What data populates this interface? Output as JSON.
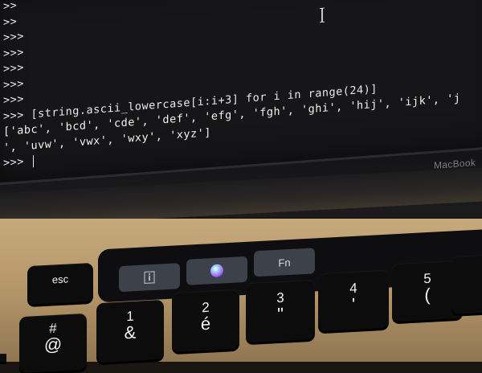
{
  "terminal": {
    "lines": [
      ">>",
      ">>",
      ">>>",
      ">>>",
      ">>>",
      ">>>",
      ">>>",
      ">>> [string.ascii_lowercase[i:i+3] for i in range(24)]",
      "['abc', 'bcd', 'cde', 'def', 'efg', 'fgh', 'ghi', 'hij', 'ijk', 'j",
      "', 'uvw', 'vwx', 'wxy', 'xyz']",
      ">>> "
    ]
  },
  "laptop": {
    "brand": "MacBook"
  },
  "touch_bar": {
    "fn_label": "Fn",
    "siri_icon": "siri-icon",
    "info_icon": "info-icon"
  },
  "keyboard": {
    "esc": "esc",
    "keys": [
      {
        "top": "#",
        "bottom": "@"
      },
      {
        "top": "1",
        "bottom": "&"
      },
      {
        "top": "2",
        "bottom": "é"
      },
      {
        "top": "3",
        "bottom": "\""
      },
      {
        "top": "4",
        "bottom": "'"
      },
      {
        "top": "5",
        "bottom": "("
      }
    ]
  },
  "colors": {
    "terminal_bg": "#161618",
    "terminal_text": "#e9e9ec",
    "deck": "#c7a97e",
    "key": "#0c0c0d",
    "touchbar_key": "#3d4149"
  }
}
